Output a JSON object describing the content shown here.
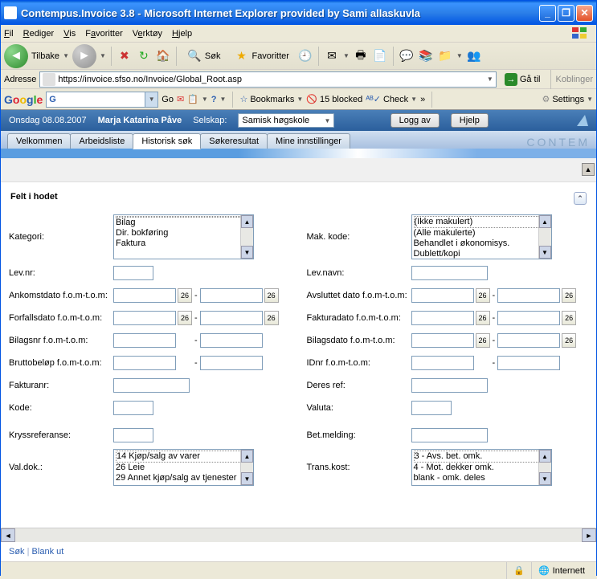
{
  "window": {
    "title": "Contempus.Invoice 3.8 - Microsoft Internet Explorer provided by Sami allaskuvla"
  },
  "menubar": {
    "file": "Fil",
    "edit": "Rediger",
    "view": "Vis",
    "favorites": "Favoritter",
    "tools": "Verktøy",
    "help": "Hjelp"
  },
  "toolbar": {
    "back": "Tilbake",
    "search": "Søk",
    "favorites": "Favoritter"
  },
  "address": {
    "label": "Adresse",
    "url": "https://invoice.sfso.no/Invoice/Global_Root.asp",
    "go": "Gå til",
    "links": "Koblinger"
  },
  "google": {
    "go": "Go",
    "bookmarks": "Bookmarks",
    "blocked": "15 blocked",
    "check": "Check",
    "settings": "Settings"
  },
  "header": {
    "date": "Onsdag 08.08.2007",
    "user": "Marja Katarina Påve",
    "selskap_label": "Selskap:",
    "selskap": "Samisk høgskole",
    "logout": "Logg av",
    "help": "Hjelp",
    "brand": "CONTEM"
  },
  "tabs": {
    "t1": "Velkommen",
    "t2": "Arbeidsliste",
    "t3": "Historisk søk",
    "t4": "Søkeresultat",
    "t5": "Mine innstillinger"
  },
  "section": {
    "title": "Felt i hodet"
  },
  "labels": {
    "left": {
      "kategori": "Kategori:",
      "levnr": "Lev.nr:",
      "ankomst": "Ankomstdato f.o.m-t.o.m:",
      "forfall": "Forfallsdato f.o.m-t.o.m:",
      "bilagsnr": "Bilagsnr f.o.m-t.o.m:",
      "brutto": "Bruttobeløp f.o.m-t.o.m:",
      "fakturanr": "Fakturanr:",
      "kode": "Kode:",
      "kryss": "Kryssreferanse:",
      "valdok": "Val.dok.:"
    },
    "right": {
      "makkode": "Mak. kode:",
      "levnavn": "Lev.navn:",
      "avsluttet": "Avsluttet dato f.o.m-t.o.m:",
      "fakturadato": "Fakturadato f.o.m-t.o.m:",
      "bilagsdato": "Bilagsdato f.o.m-t.o.m:",
      "idnr": "IDnr f.o.m-t.o.m:",
      "deresref": "Deres ref:",
      "valuta": "Valuta:",
      "betmelding": "Bet.melding:",
      "transkost": "Trans.kost:"
    }
  },
  "lists": {
    "kategori": [
      "",
      "Bilag",
      "Dir. bokføring",
      "Faktura"
    ],
    "makkode": [
      "(Ikke makulert)",
      "(Alle makulerte)",
      "Behandlet i økonomisys.",
      "Dublett/kopi"
    ],
    "valdok": [
      "14 Kjøp/salg av varer",
      "26 Leie",
      "29 Annet kjøp/salg av tjenester"
    ],
    "transkost": [
      "3 - Avs. bet. omk.",
      "4 - Mot. dekker omk.",
      "blank - omk. deles"
    ]
  },
  "footer": {
    "sok": "Søk",
    "blank": "Blank ut",
    "status": "Internett"
  }
}
